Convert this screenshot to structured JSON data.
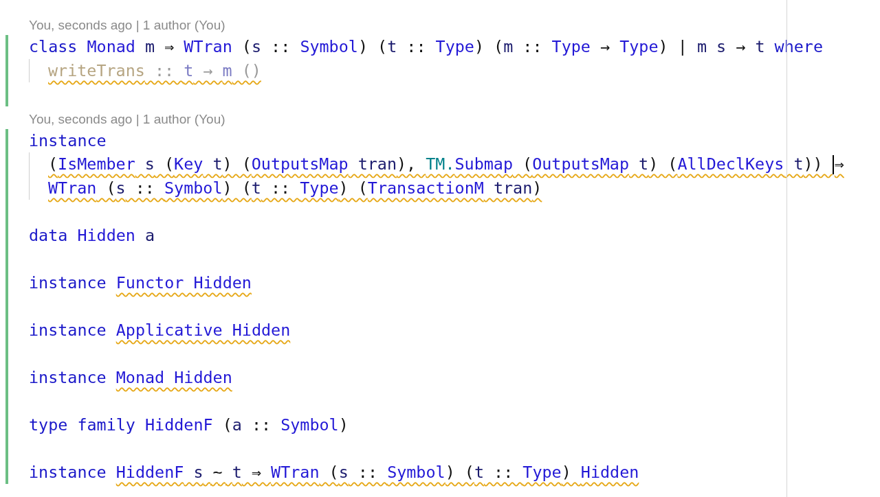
{
  "blame_blocks": [
    {
      "annotation": "You, seconds ago | 1 author (You)",
      "changed": true,
      "lines": [
        {
          "kind": "code",
          "tokens": [
            {
              "text": "class ",
              "kind": "keyword",
              "warn": false
            },
            {
              "text": "Monad",
              "kind": "type",
              "warn": false
            },
            {
              "text": " m",
              "kind": "var",
              "warn": false
            },
            {
              "text": " ⇒ ",
              "kind": "punct",
              "warn": false
            },
            {
              "text": "WTran",
              "kind": "type",
              "warn": false
            },
            {
              "text": " (",
              "kind": "punct",
              "warn": false
            },
            {
              "text": "s",
              "kind": "var",
              "warn": false
            },
            {
              "text": " :: ",
              "kind": "punct",
              "warn": false
            },
            {
              "text": "Symbol",
              "kind": "type",
              "warn": false
            },
            {
              "text": ") (",
              "kind": "punct",
              "warn": false
            },
            {
              "text": "t",
              "kind": "var",
              "warn": false
            },
            {
              "text": " :: ",
              "kind": "punct",
              "warn": false
            },
            {
              "text": "Type",
              "kind": "type",
              "warn": false
            },
            {
              "text": ") (",
              "kind": "punct",
              "warn": false
            },
            {
              "text": "m",
              "kind": "var",
              "warn": false
            },
            {
              "text": " :: ",
              "kind": "punct",
              "warn": false
            },
            {
              "text": "Type",
              "kind": "type",
              "warn": false
            },
            {
              "text": " → ",
              "kind": "punct",
              "warn": false
            },
            {
              "text": "Type",
              "kind": "type",
              "warn": false
            },
            {
              "text": ") | ",
              "kind": "punct",
              "warn": false
            },
            {
              "text": "m s",
              "kind": "var",
              "warn": false
            },
            {
              "text": " → ",
              "kind": "punct",
              "warn": false
            },
            {
              "text": "t ",
              "kind": "var",
              "warn": false
            },
            {
              "text": "where",
              "kind": "keyword",
              "warn": false
            }
          ],
          "children": [
            {
              "kind": "code",
              "tokens": [
                {
                  "text": "writeTrans",
                  "kind": "dim-name",
                  "warn": true
                },
                {
                  "text": " :: ",
                  "kind": "dim-op",
                  "warn": true
                },
                {
                  "text": "t",
                  "kind": "dim-var",
                  "warn": true
                },
                {
                  "text": " → ",
                  "kind": "dim-op",
                  "warn": true
                },
                {
                  "text": "m",
                  "kind": "dim-var",
                  "warn": true
                },
                {
                  "text": " ()",
                  "kind": "dim-op",
                  "warn": true
                }
              ]
            }
          ]
        },
        {
          "kind": "blank"
        }
      ]
    },
    {
      "annotation": "You, seconds ago | 1 author (You)",
      "changed": true,
      "lines": [
        {
          "kind": "code",
          "tokens": [
            {
              "text": "instance",
              "kind": "keyword",
              "warn": false
            }
          ],
          "children": [
            {
              "kind": "code",
              "tokens": [
                {
                  "text": "(",
                  "kind": "punct",
                  "warn": true
                },
                {
                  "text": "IsMember",
                  "kind": "type",
                  "warn": true
                },
                {
                  "text": " s",
                  "kind": "var",
                  "warn": true
                },
                {
                  "text": " (",
                  "kind": "punct",
                  "warn": true
                },
                {
                  "text": "Key",
                  "kind": "type",
                  "warn": true
                },
                {
                  "text": " t",
                  "kind": "var",
                  "warn": true
                },
                {
                  "text": ") (",
                  "kind": "punct",
                  "warn": true
                },
                {
                  "text": "OutputsMap",
                  "kind": "type",
                  "warn": true
                },
                {
                  "text": " tran",
                  "kind": "var",
                  "warn": true
                },
                {
                  "text": "), ",
                  "kind": "punct",
                  "warn": true
                },
                {
                  "text": "TM.",
                  "kind": "module",
                  "warn": true
                },
                {
                  "text": "Submap",
                  "kind": "type",
                  "warn": true
                },
                {
                  "text": " (",
                  "kind": "punct",
                  "warn": true
                },
                {
                  "text": "OutputsMap",
                  "kind": "type",
                  "warn": true
                },
                {
                  "text": " t",
                  "kind": "var",
                  "warn": true
                },
                {
                  "text": ") (",
                  "kind": "punct",
                  "warn": true
                },
                {
                  "text": "AllDeclKeys",
                  "kind": "type",
                  "warn": true
                },
                {
                  "text": " t",
                  "kind": "var",
                  "warn": true
                },
                {
                  "text": ")) ",
                  "kind": "punct",
                  "warn": true
                },
                {
                  "text": "⇒",
                  "kind": "punct",
                  "warn": true,
                  "caret": true
                }
              ]
            },
            {
              "kind": "code",
              "tokens": [
                {
                  "text": "WTran",
                  "kind": "type",
                  "warn": true
                },
                {
                  "text": " (",
                  "kind": "punct",
                  "warn": true
                },
                {
                  "text": "s",
                  "kind": "var",
                  "warn": true
                },
                {
                  "text": " :: ",
                  "kind": "punct",
                  "warn": true
                },
                {
                  "text": "Symbol",
                  "kind": "type",
                  "warn": true
                },
                {
                  "text": ") (",
                  "kind": "punct",
                  "warn": true
                },
                {
                  "text": "t",
                  "kind": "var",
                  "warn": true
                },
                {
                  "text": " :: ",
                  "kind": "punct",
                  "warn": true
                },
                {
                  "text": "Type",
                  "kind": "type",
                  "warn": true
                },
                {
                  "text": ") (",
                  "kind": "punct",
                  "warn": true
                },
                {
                  "text": "TransactionM",
                  "kind": "type",
                  "warn": true
                },
                {
                  "text": " tran",
                  "kind": "var",
                  "warn": true
                },
                {
                  "text": ")",
                  "kind": "punct",
                  "warn": true
                }
              ]
            }
          ]
        },
        {
          "kind": "blank"
        },
        {
          "kind": "code",
          "tokens": [
            {
              "text": "data ",
              "kind": "keyword",
              "warn": false
            },
            {
              "text": "Hidden",
              "kind": "type",
              "warn": false
            },
            {
              "text": " a",
              "kind": "var",
              "warn": false
            }
          ]
        },
        {
          "kind": "blank"
        },
        {
          "kind": "code",
          "tokens": [
            {
              "text": "instance ",
              "kind": "keyword",
              "warn": false
            },
            {
              "text": "Functor Hidden",
              "kind": "type",
              "warn": true
            }
          ]
        },
        {
          "kind": "blank"
        },
        {
          "kind": "code",
          "tokens": [
            {
              "text": "instance ",
              "kind": "keyword",
              "warn": false
            },
            {
              "text": "Applicative Hidden",
              "kind": "type",
              "warn": true
            }
          ]
        },
        {
          "kind": "blank"
        },
        {
          "kind": "code",
          "tokens": [
            {
              "text": "instance ",
              "kind": "keyword",
              "warn": false
            },
            {
              "text": "Monad Hidden",
              "kind": "type",
              "warn": true
            }
          ]
        },
        {
          "kind": "blank"
        },
        {
          "kind": "code",
          "tokens": [
            {
              "text": "type family ",
              "kind": "keyword",
              "warn": false
            },
            {
              "text": "HiddenF",
              "kind": "type",
              "warn": false
            },
            {
              "text": " (",
              "kind": "punct",
              "warn": false
            },
            {
              "text": "a",
              "kind": "var",
              "warn": false
            },
            {
              "text": " :: ",
              "kind": "punct",
              "warn": false
            },
            {
              "text": "Symbol",
              "kind": "type",
              "warn": false
            },
            {
              "text": ")",
              "kind": "punct",
              "warn": false
            }
          ]
        },
        {
          "kind": "blank"
        },
        {
          "kind": "code",
          "tokens": [
            {
              "text": "instance ",
              "kind": "keyword",
              "warn": false
            },
            {
              "text": "HiddenF",
              "kind": "type",
              "warn": true
            },
            {
              "text": " s",
              "kind": "var",
              "warn": true
            },
            {
              "text": " ~ ",
              "kind": "punct",
              "warn": true
            },
            {
              "text": "t",
              "kind": "var",
              "warn": true
            },
            {
              "text": " ⇒ ",
              "kind": "punct",
              "warn": true
            },
            {
              "text": "WTran",
              "kind": "type",
              "warn": true
            },
            {
              "text": " (",
              "kind": "punct",
              "warn": true
            },
            {
              "text": "s",
              "kind": "var",
              "warn": true
            },
            {
              "text": " :: ",
              "kind": "punct",
              "warn": true
            },
            {
              "text": "Symbol",
              "kind": "type",
              "warn": true
            },
            {
              "text": ") (",
              "kind": "punct",
              "warn": true
            },
            {
              "text": "t",
              "kind": "var",
              "warn": true
            },
            {
              "text": " :: ",
              "kind": "punct",
              "warn": true
            },
            {
              "text": "Type",
              "kind": "type",
              "warn": true
            },
            {
              "text": ") ",
              "kind": "punct",
              "warn": true
            },
            {
              "text": "Hidden",
              "kind": "type",
              "warn": true
            }
          ]
        }
      ]
    }
  ]
}
